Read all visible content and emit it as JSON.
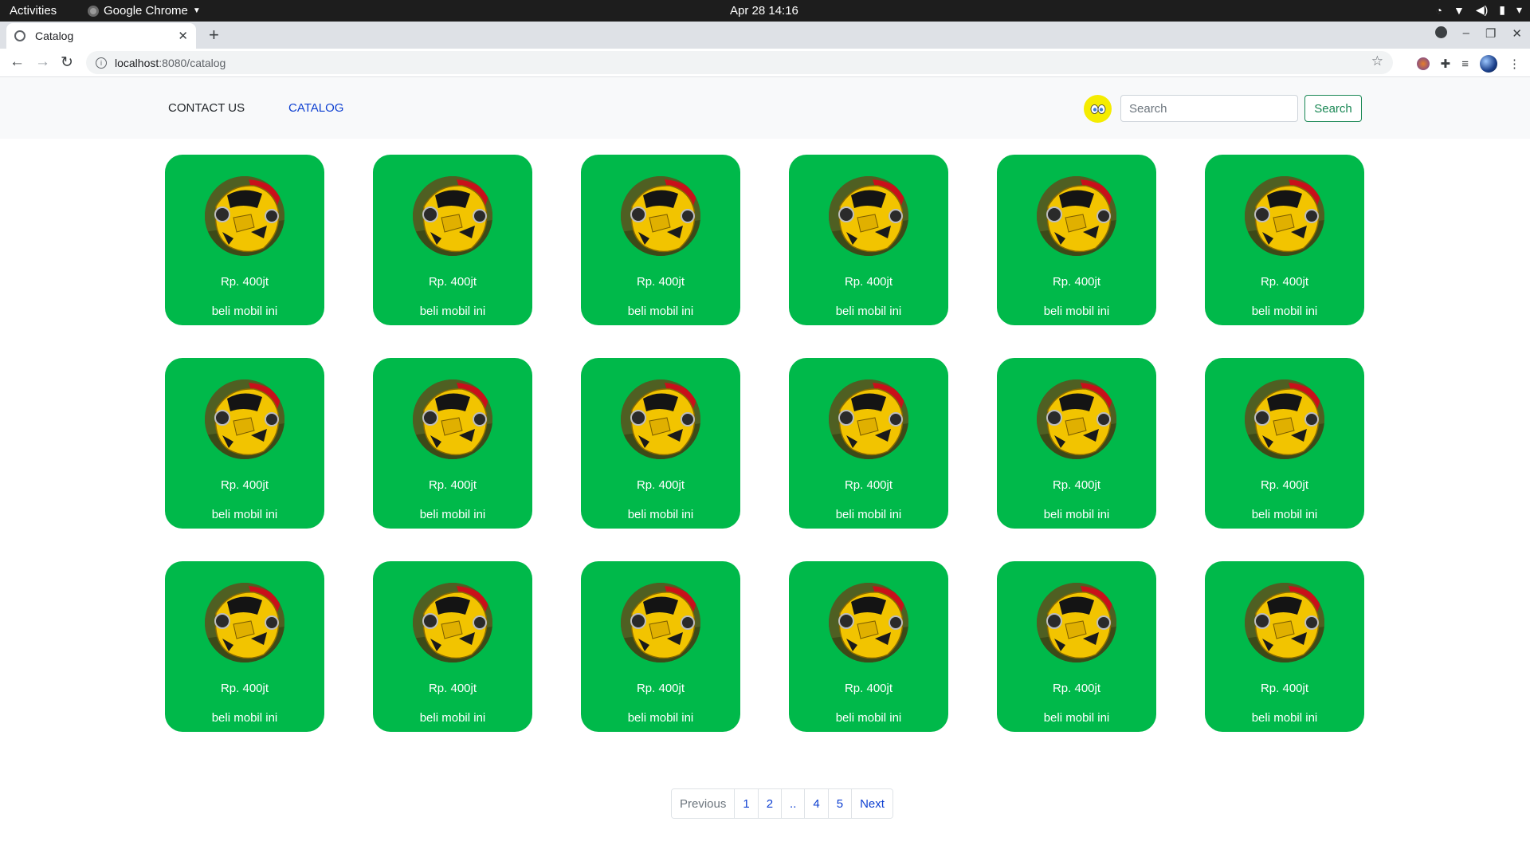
{
  "os": {
    "activities": "Activities",
    "app_name": "Google Chrome",
    "clock": "Apr 28  14:16"
  },
  "browser": {
    "tab_title": "Catalog",
    "url_host": "localhost",
    "url_path": ":8080/catalog"
  },
  "nav": {
    "contact": "CONTACT US",
    "catalog": "CATALOG"
  },
  "search": {
    "placeholder": "Search",
    "button": "Search"
  },
  "colors": {
    "card_bg": "#00b94a",
    "link": "#0d3fd1",
    "search_btn": "#198754"
  },
  "cards": [
    {
      "price": "Rp. 400jt",
      "action": "beli mobil ini"
    },
    {
      "price": "Rp. 400jt",
      "action": "beli mobil ini"
    },
    {
      "price": "Rp. 400jt",
      "action": "beli mobil ini"
    },
    {
      "price": "Rp. 400jt",
      "action": "beli mobil ini"
    },
    {
      "price": "Rp. 400jt",
      "action": "beli mobil ini"
    },
    {
      "price": "Rp. 400jt",
      "action": "beli mobil ini"
    },
    {
      "price": "Rp. 400jt",
      "action": "beli mobil ini"
    },
    {
      "price": "Rp. 400jt",
      "action": "beli mobil ini"
    },
    {
      "price": "Rp. 400jt",
      "action": "beli mobil ini"
    },
    {
      "price": "Rp. 400jt",
      "action": "beli mobil ini"
    },
    {
      "price": "Rp. 400jt",
      "action": "beli mobil ini"
    },
    {
      "price": "Rp. 400jt",
      "action": "beli mobil ini"
    },
    {
      "price": "Rp. 400jt",
      "action": "beli mobil ini"
    },
    {
      "price": "Rp. 400jt",
      "action": "beli mobil ini"
    },
    {
      "price": "Rp. 400jt",
      "action": "beli mobil ini"
    },
    {
      "price": "Rp. 400jt",
      "action": "beli mobil ini"
    },
    {
      "price": "Rp. 400jt",
      "action": "beli mobil ini"
    },
    {
      "price": "Rp. 400jt",
      "action": "beli mobil ini"
    }
  ],
  "pagination": {
    "previous": "Previous",
    "pages": [
      "1",
      "2",
      "..",
      "4",
      "5"
    ],
    "next": "Next"
  }
}
